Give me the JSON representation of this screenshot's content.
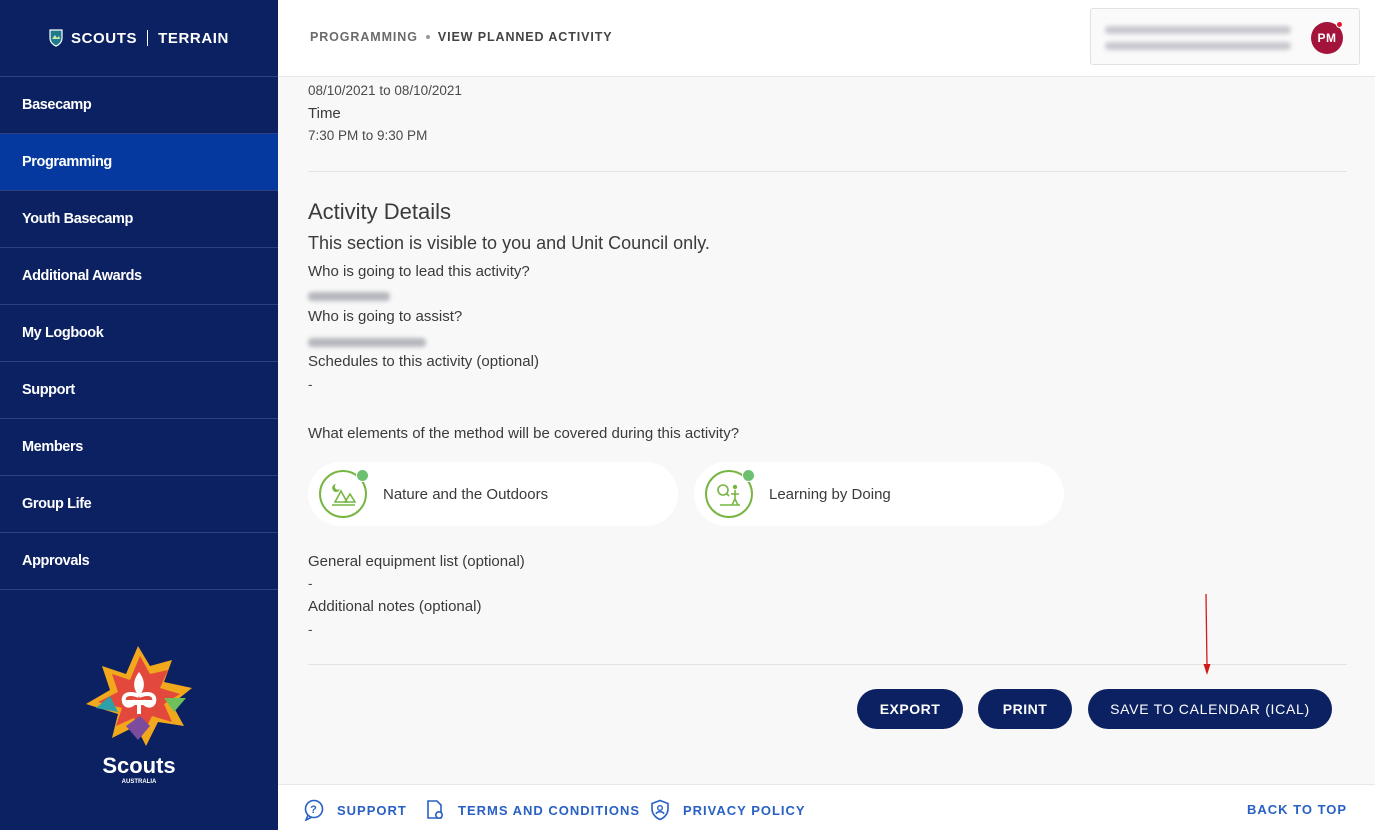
{
  "brand": {
    "name": "SCOUTS",
    "product": "TERRAIN"
  },
  "sidebar": {
    "items": [
      {
        "label": "Basecamp",
        "active": false
      },
      {
        "label": "Programming",
        "active": true
      },
      {
        "label": "Youth Basecamp",
        "active": false
      },
      {
        "label": "Additional Awards",
        "active": false
      },
      {
        "label": "My Logbook",
        "active": false
      },
      {
        "label": "Support",
        "active": false
      },
      {
        "label": "Members",
        "active": false
      },
      {
        "label": "Group Life",
        "active": false
      },
      {
        "label": "Approvals",
        "active": false
      }
    ],
    "logo": {
      "wordmark": "Scouts",
      "sub": "AUSTRALIA"
    }
  },
  "header": {
    "breadcrumb": {
      "parent": "PROGRAMMING",
      "current": "VIEW PLANNED ACTIVITY"
    },
    "user": {
      "initials": "PM"
    }
  },
  "activity": {
    "date_range": "08/10/2021 to 08/10/2021",
    "time_label": "Time",
    "time_value": "7:30 PM to 9:30 PM",
    "details_title": "Activity Details",
    "visibility_note": "This section is visible to you and Unit Council only.",
    "lead_label": "Who is going to lead this activity?",
    "assist_label": "Who is going to assist?",
    "schedules_label": "Schedules to this activity (optional)",
    "schedules_value": "-",
    "method_question": "What elements of the method will be covered during this activity?",
    "methods": [
      {
        "label": "Nature and the Outdoors",
        "icon": "nature-outdoors-icon"
      },
      {
        "label": "Learning by Doing",
        "icon": "learning-by-doing-icon"
      }
    ],
    "equipment_label": "General equipment list (optional)",
    "equipment_value": "-",
    "notes_label": "Additional notes (optional)",
    "notes_value": "-"
  },
  "actions": {
    "export": "EXPORT",
    "print": "PRINT",
    "save_calendar": "SAVE TO CALENDAR (ICAL)"
  },
  "footer": {
    "support": "SUPPORT",
    "terms": "TERMS AND CONDITIONS",
    "privacy": "PRIVACY POLICY",
    "back_to_top": "BACK TO TOP"
  },
  "colors": {
    "sidebar_bg": "#0c2161",
    "sidebar_active": "#06399f",
    "button_bg": "#0c2161",
    "link": "#2860c4",
    "method_green": "#78b543",
    "avatar": "#a3133a",
    "annotation_arrow": "#d11a1a"
  }
}
